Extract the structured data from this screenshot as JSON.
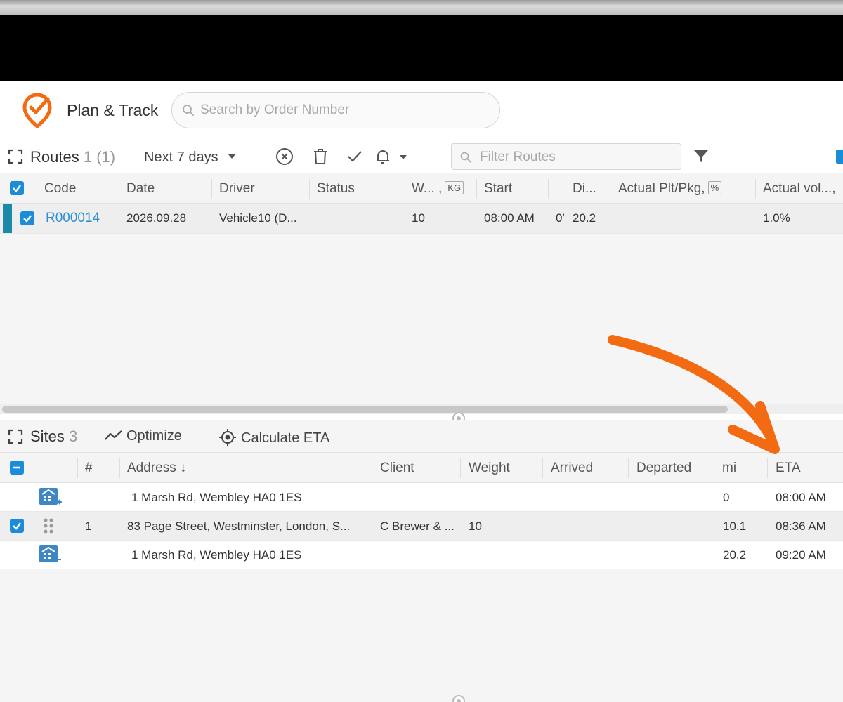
{
  "app": {
    "title": "Plan & Track"
  },
  "search": {
    "placeholder": "Search by Order Number"
  },
  "routes": {
    "title": "Routes",
    "count": "1 (1)",
    "range": "Next 7 days",
    "filter_placeholder": "Filter Routes",
    "columns": [
      {
        "label": "Code"
      },
      {
        "label": "Date"
      },
      {
        "label": "Driver"
      },
      {
        "label": "Status"
      },
      {
        "label": "W... ,",
        "unit": "KG"
      },
      {
        "label": "Start"
      },
      {
        "label": "Di..."
      },
      {
        "label": "Actual Plt/Pkg,",
        "unit": "%"
      },
      {
        "label": "Actual vol...,"
      }
    ],
    "rows": [
      {
        "code": "R000014",
        "date": "2026.09.28",
        "driver": "Vehicle10 (D...",
        "status": "",
        "weight": "10",
        "start": "08:00 AM",
        "extra": "0'",
        "distance": "20.2",
        "actual_plt": "",
        "actual_vol": "1.0%"
      }
    ]
  },
  "sites": {
    "title": "Sites",
    "count": "3",
    "optimize_label": "Optimize",
    "calc_eta_label": "Calculate ETA",
    "columns": [
      {
        "label": "#"
      },
      {
        "label": "Address ↓"
      },
      {
        "label": "Client"
      },
      {
        "label": "Weight"
      },
      {
        "label": "Arrived"
      },
      {
        "label": "Departed"
      },
      {
        "label": "mi"
      },
      {
        "label": "ETA"
      }
    ],
    "rows": [
      {
        "type": "depot-start",
        "num": "",
        "address": "1 Marsh Rd, Wembley HA0 1ES",
        "client": "",
        "weight": "",
        "arrived": "",
        "departed": "",
        "mi": "0",
        "eta": "08:00 AM"
      },
      {
        "type": "stop",
        "num": "1",
        "address": "83 Page Street, Westminster, London, S...",
        "client": "C Brewer & ...",
        "weight": "10",
        "arrived": "",
        "departed": "",
        "mi": "10.1",
        "eta": "08:36 AM"
      },
      {
        "type": "depot-end",
        "num": "",
        "address": "1 Marsh Rd, Wembley HA0 1ES",
        "client": "",
        "weight": "",
        "arrived": "",
        "departed": "",
        "mi": "20.2",
        "eta": "09:20 AM"
      }
    ]
  },
  "colors": {
    "accent": "#1a8cd8",
    "link": "#2b8fd6",
    "annotation_arrow": "#f26a12",
    "logo": "#f26a12",
    "row_marker": "#1b8aa8"
  }
}
